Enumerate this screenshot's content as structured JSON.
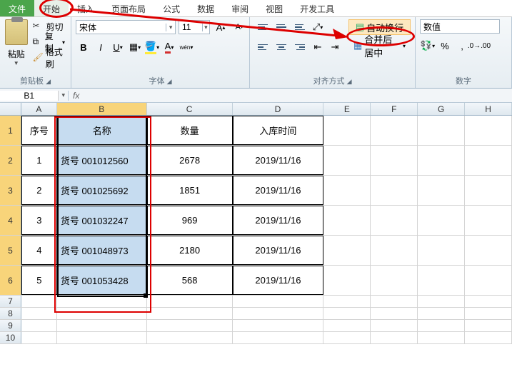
{
  "tabs": {
    "file": "文件",
    "home": "开始",
    "insert": "插入",
    "layout": "页面布局",
    "formulas": "公式",
    "data": "数据",
    "review": "审阅",
    "view": "视图",
    "dev": "开发工具"
  },
  "ribbon": {
    "clipboard": {
      "label": "剪贴板",
      "paste": "粘贴",
      "cut": "剪切",
      "copy": "复制",
      "format_painter": "格式刷"
    },
    "font": {
      "label": "字体",
      "name": "宋体",
      "size": "11"
    },
    "alignment": {
      "label": "对齐方式",
      "wrap": "自动换行",
      "merge": "合并后居中"
    },
    "number": {
      "label": "数字",
      "format": "数值"
    }
  },
  "namebox": "B1",
  "columns": [
    "A",
    "B",
    "C",
    "D",
    "E",
    "F",
    "G",
    "H"
  ],
  "data_rows": [
    {
      "n": "序号",
      "name": "名称",
      "qty": "数量",
      "date": "入库时间"
    },
    {
      "n": "1",
      "name": "货号 001012560",
      "qty": "2678",
      "date": "2019/11/16"
    },
    {
      "n": "2",
      "name": "货号 001025692",
      "qty": "1851",
      "date": "2019/11/16"
    },
    {
      "n": "3",
      "name": "货号 001032247",
      "qty": "969",
      "date": "2019/11/16"
    },
    {
      "n": "4",
      "name": "货号 001048973",
      "qty": "2180",
      "date": "2019/11/16"
    },
    {
      "n": "5",
      "name": "货号 001053428",
      "qty": "568",
      "date": "2019/11/16"
    }
  ]
}
